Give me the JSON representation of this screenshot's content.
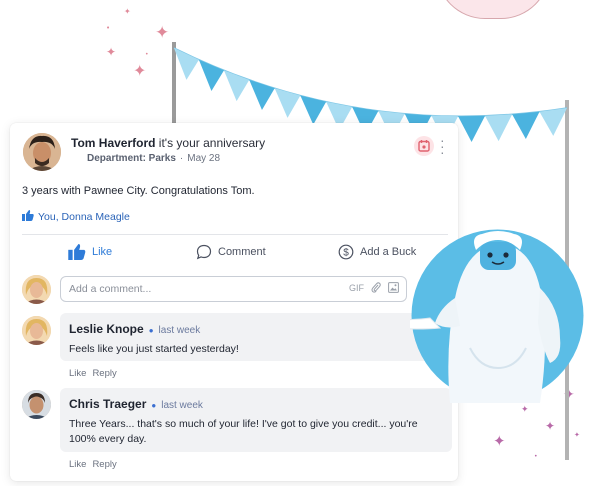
{
  "post": {
    "author_name": "Tom Haverford",
    "headline_rest": " it's your anniversary",
    "department": "Department: Parks",
    "date": "May 28",
    "text": "3 years with Pawnee City. Congratulations Tom.",
    "likers": "You, Donna Meagle"
  },
  "actions": {
    "like": "Like",
    "comment": "Comment",
    "buck": "Add a Buck"
  },
  "comment_input": {
    "placeholder": "Add a comment...",
    "gif_label": "GIF"
  },
  "comments": [
    {
      "author": "Leslie Knope",
      "time": "last week",
      "text": "Feels like you just started yesterday!",
      "like": "Like",
      "reply": "Reply"
    },
    {
      "author": "Chris Traeger",
      "time": "last week",
      "text": "Three Years... that's so much of your life! I've got to give you credit... you're 100% every day.",
      "like": "Like",
      "reply": "Reply"
    }
  ],
  "colors": {
    "accent": "#2e7bd8",
    "bunting_dark": "#4bb3df",
    "bunting_light": "#a9ddf2",
    "yeti_circle": "#5bbde6",
    "calendar_icon": "#e0626f"
  }
}
